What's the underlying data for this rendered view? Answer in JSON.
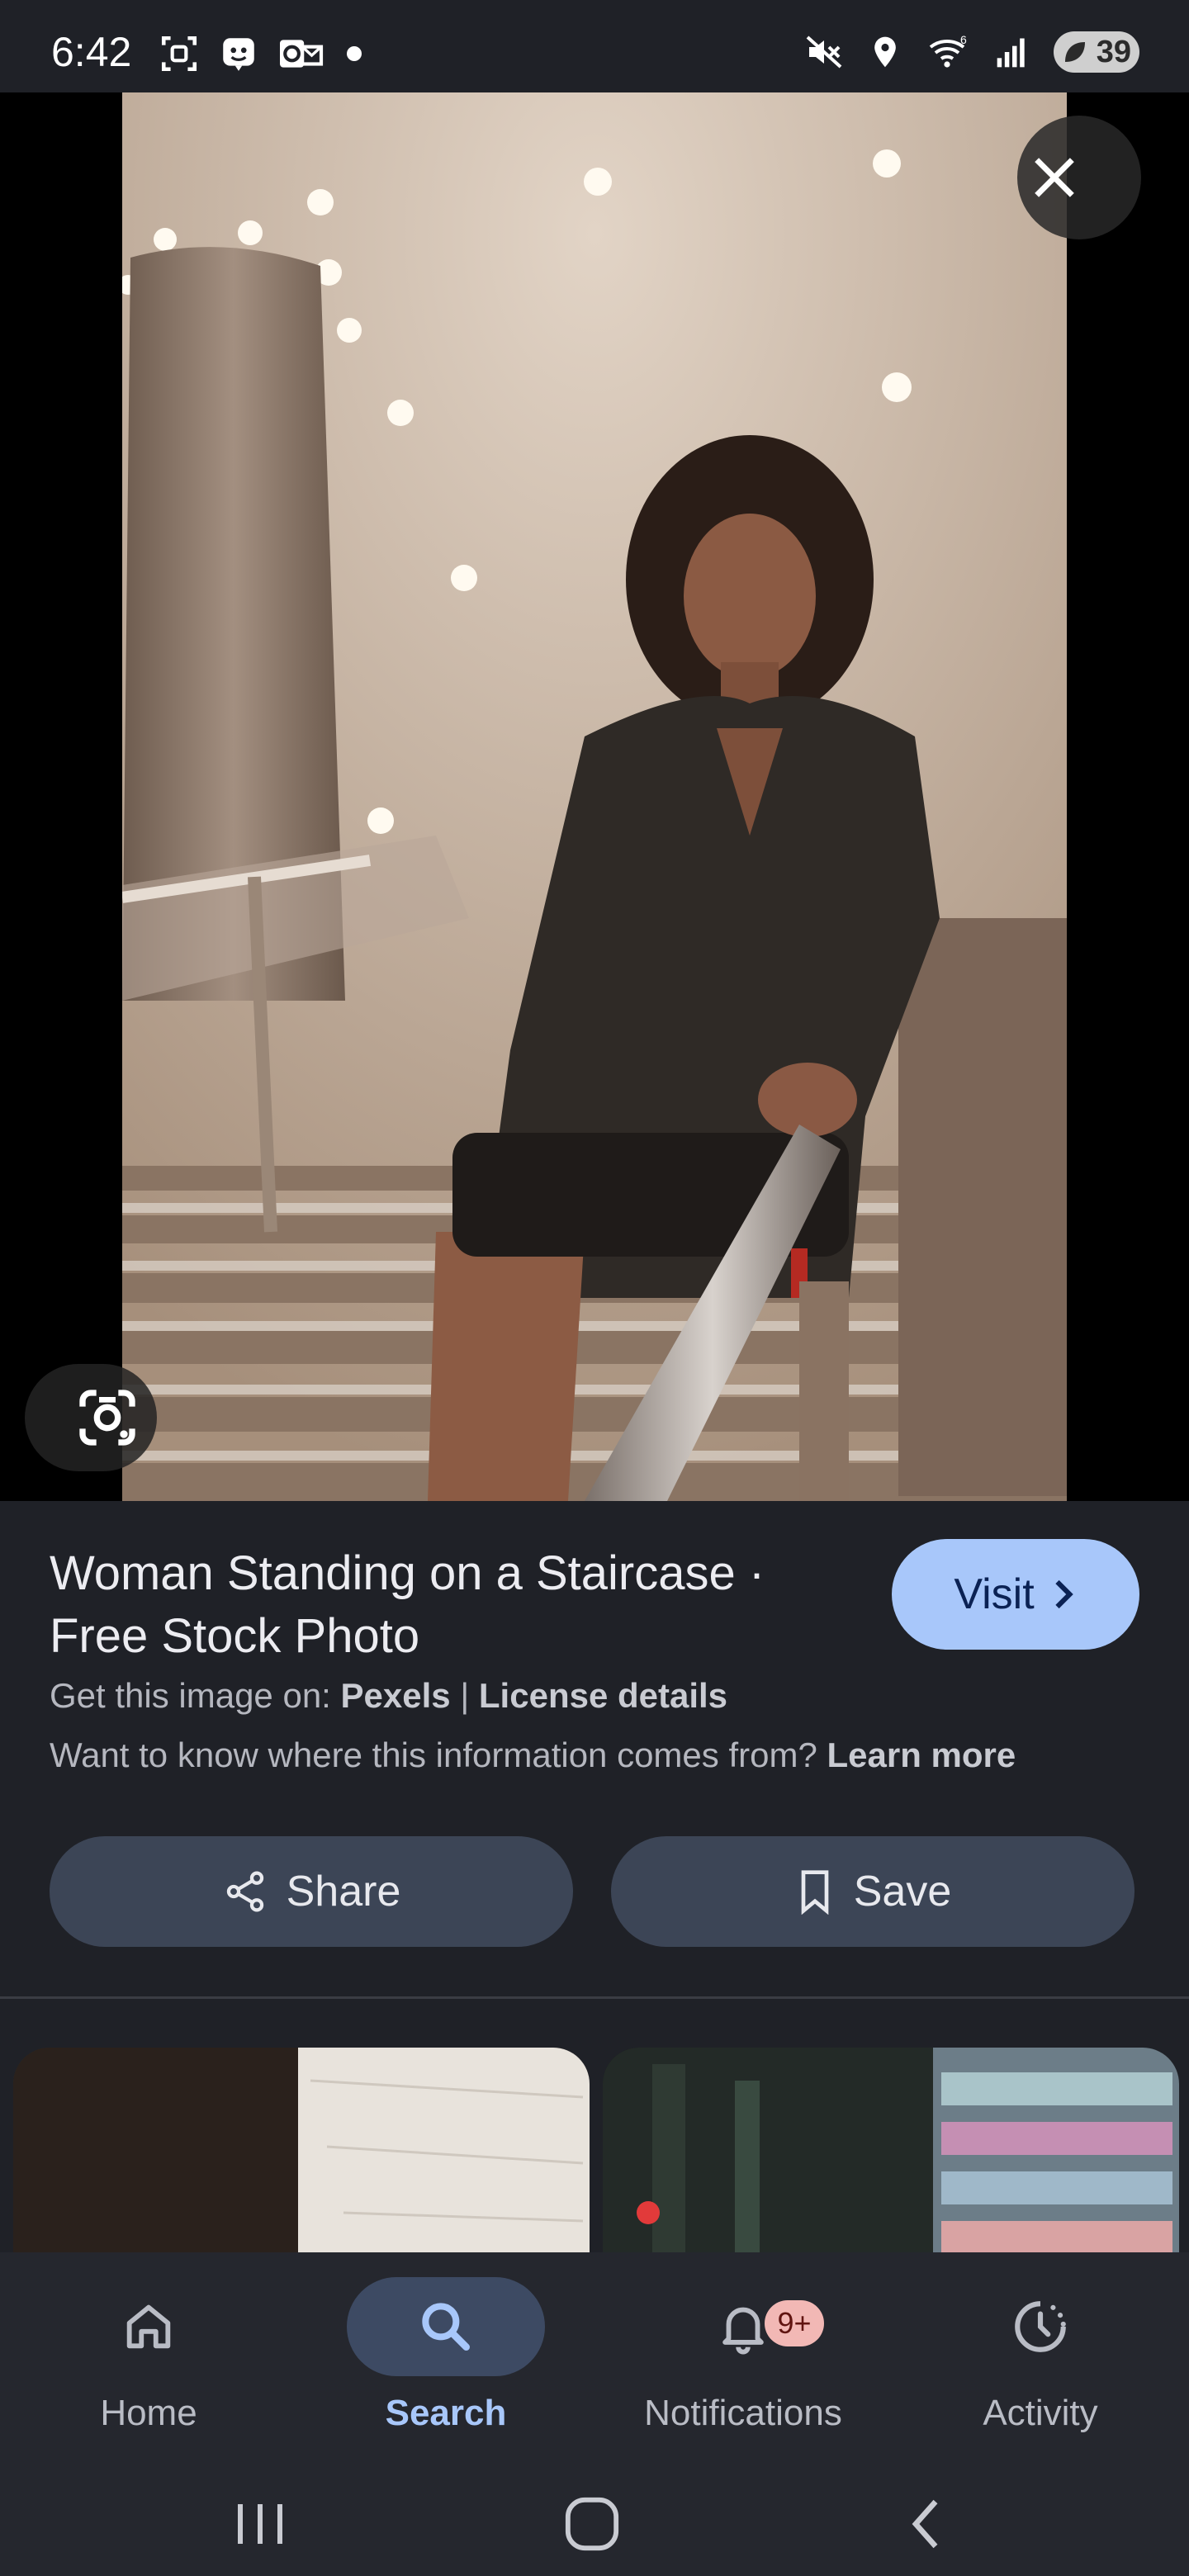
{
  "status_bar": {
    "time": "6:42",
    "battery": "39",
    "left_icons": [
      "screenshot-icon",
      "bot-icon",
      "outlook-icon",
      "dot-icon"
    ],
    "right_icons": [
      "mute-icon",
      "location-icon",
      "wifi-icon",
      "signal-icon",
      "battery-icon"
    ]
  },
  "result": {
    "title": "Woman Standing on a Staircase · Free Stock Photo",
    "visit_label": "Visit",
    "source_prefix": "Get this image on:",
    "source_name": "Pexels",
    "separator": "|",
    "license_label": "License details",
    "learn_question": "Want to know where this information comes from?",
    "learn_more": "Learn more",
    "share_label": "Share",
    "save_label": "Save"
  },
  "bottom_nav": {
    "items": [
      {
        "label": "Home",
        "icon": "home-icon"
      },
      {
        "label": "Search",
        "icon": "search-icon",
        "active": true
      },
      {
        "label": "Notifications",
        "icon": "bell-icon",
        "badge": "9+"
      },
      {
        "label": "Activity",
        "icon": "activity-icon"
      }
    ]
  },
  "colors": {
    "background": "#1f2127",
    "accent": "#a8c7fa",
    "button": "#3c4556",
    "badge": "#f2b8b5"
  }
}
